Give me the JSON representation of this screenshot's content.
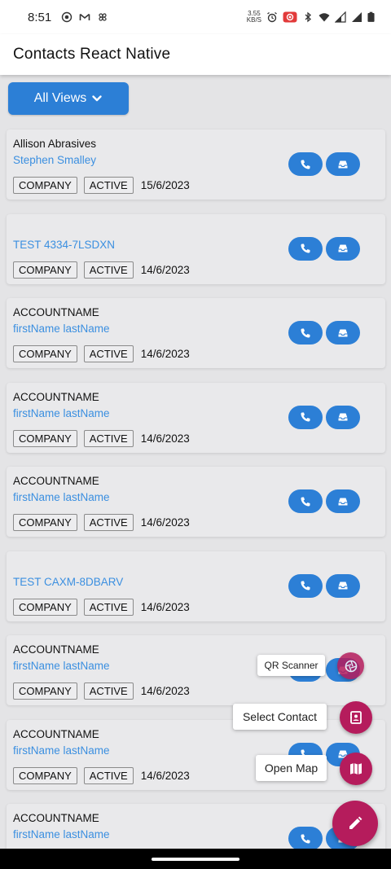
{
  "status_bar": {
    "time": "8:51",
    "net_speed_value": "3.55",
    "net_speed_unit": "KB/S"
  },
  "app_bar": {
    "title": "Contacts React Native"
  },
  "views_button": {
    "label": "All Views"
  },
  "contacts": [
    {
      "account": "Allison Abrasives",
      "contact": "Stephen Smalley",
      "type": "COMPANY",
      "status": "ACTIVE",
      "date": "15/6/2023"
    },
    {
      "account": "",
      "contact": "TEST 4334-7LSDXN",
      "type": "COMPANY",
      "status": "ACTIVE",
      "date": "14/6/2023"
    },
    {
      "account": "ACCOUNTNAME",
      "contact": "firstName lastName",
      "type": "COMPANY",
      "status": "ACTIVE",
      "date": "14/6/2023"
    },
    {
      "account": "ACCOUNTNAME",
      "contact": "firstName lastName",
      "type": "COMPANY",
      "status": "ACTIVE",
      "date": "14/6/2023"
    },
    {
      "account": "ACCOUNTNAME",
      "contact": "firstName lastName",
      "type": "COMPANY",
      "status": "ACTIVE",
      "date": "14/6/2023"
    },
    {
      "account": "",
      "contact": "TEST CAXM-8DBARV",
      "type": "COMPANY",
      "status": "ACTIVE",
      "date": "14/6/2023"
    },
    {
      "account": "ACCOUNTNAME",
      "contact": "firstName lastName",
      "type": "COMPANY",
      "status": "ACTIVE",
      "date": "14/6/2023"
    },
    {
      "account": "ACCOUNTNAME",
      "contact": "firstName lastName",
      "type": "COMPANY",
      "status": "ACTIVE",
      "date": "14/6/2023"
    },
    {
      "account": "ACCOUNTNAME",
      "contact": "firstName lastName",
      "type": "",
      "status": "",
      "date": ""
    }
  ],
  "fab_actions": {
    "qr_scanner": "QR Scanner",
    "select_contact": "Select Contact",
    "open_map": "Open Map"
  },
  "colors": {
    "primary": "#2c7fd6",
    "accent": "#b51c5c",
    "link": "#3b8fe0",
    "card": "#e9e9eb"
  },
  "icons": {
    "views_button": "chevron-down-icon",
    "call": "phone-icon",
    "mail": "inbox-icon",
    "qr": "camera-aperture-icon",
    "contact": "contact-book-icon",
    "map": "map-icon",
    "fab": "pencil-icon"
  }
}
